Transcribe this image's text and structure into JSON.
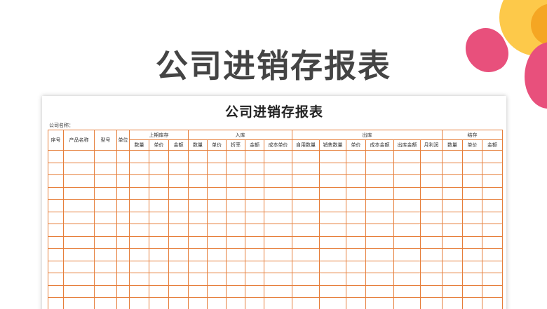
{
  "slide": {
    "title": "公司进销存报表"
  },
  "document": {
    "title": "公司进销存报表",
    "company_label": "公司名称：",
    "columns_fixed": [
      "序号",
      "产品名称",
      "型号",
      "单位"
    ],
    "groups": [
      {
        "label": "上期库存",
        "sub": [
          "数量",
          "单价",
          "金额"
        ]
      },
      {
        "label": "入库",
        "sub": [
          "数量",
          "单价",
          "折率",
          "金额",
          "成本单价"
        ]
      },
      {
        "label": "出库",
        "sub": [
          "自用数量",
          "销售数量",
          "单价",
          "成本金额",
          "出库金额",
          "月利润"
        ]
      },
      {
        "label": "结存",
        "sub": [
          "数量",
          "单价",
          "金额"
        ]
      }
    ],
    "empty_rows": 13
  },
  "colors": {
    "grid": "#e67e3a",
    "accent_pink": "#e8507c",
    "accent_yellow": "#fdc94a"
  }
}
